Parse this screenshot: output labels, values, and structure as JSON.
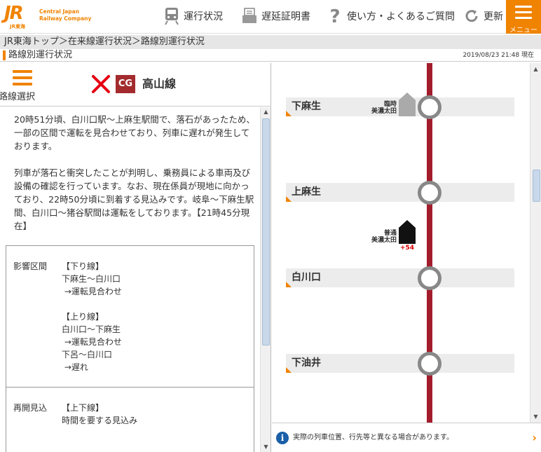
{
  "header": {
    "logo_jr": "JR",
    "logo_sub": "JR東海",
    "logo_en_line1": "Central Japan",
    "logo_en_line2": "Railway Company",
    "nav": [
      {
        "label": "運行状況",
        "icon": "train-icon"
      },
      {
        "label": "遅延証明書",
        "icon": "certificate-icon"
      },
      {
        "label": "使い方・よくあるご質問",
        "icon": "question-icon"
      },
      {
        "label": "更新",
        "icon": "refresh-icon"
      }
    ],
    "menu_label": "メニュー",
    "accent_color": "#f08300"
  },
  "breadcrumb": "JR東海トップ＞在来線運行状況＞路線別運行状況",
  "title": "路線別運行状況",
  "timestamp": "2019/08/23 21:48 現在",
  "route": {
    "select_label": "路線選択",
    "status_icon": "x-mark-icon",
    "line_code": "CG",
    "line_name": "高山線",
    "line_color": "#a32b2e"
  },
  "message": {
    "p1": "20時51分頃、白川口駅～上麻生駅間で、落石があったため、一部の区間で運転を見合わせており、列車に遅れが発生しております。",
    "p2": "列車が落石と衝突したことが判明し、乗務員による車両及び設備の確認を行っています。なお、現在係員が現地に向かっており、22時50分頃に到着する見込みです。岐阜～下麻生駅間、白川口～猪谷駅間は運転をしております。【21時45分現在】"
  },
  "info": {
    "affected_key": "影響区間",
    "affected_val": "【下り線】\n下麻生～白川口\n →運転見合わせ\n\n【上り線】\n白川口～下麻生\n →運転見合わせ\n下呂～白川口\n →遅れ",
    "resume_key": "再開見込",
    "resume_val": "【上下線】\n時間を要する見込み"
  },
  "map": {
    "stations": [
      "下麻生",
      "上麻生",
      "白川口",
      "下油井"
    ],
    "trains": [
      {
        "type": "臨時",
        "dest": "美濃太田",
        "delay": ""
      },
      {
        "type": "普通",
        "dest": "美濃太田",
        "delay": "+54"
      }
    ]
  },
  "notice": "実際の列車位置、行先等と異なる場合があります。"
}
